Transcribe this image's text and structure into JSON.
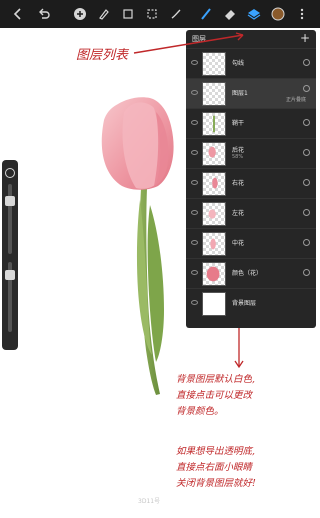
{
  "toolbar": {
    "icons": [
      "back-icon",
      "undo-icon",
      "add-icon",
      "brush-adjust-icon",
      "crop-icon",
      "select-icon",
      "smudge-icon",
      "brush-icon",
      "eraser-icon",
      "layers-icon",
      "color-icon",
      "more-icon"
    ],
    "accent": "#3aa3ff",
    "color_swatch": "#8a5a2b"
  },
  "layers_panel": {
    "title": "图层",
    "add_label": "+",
    "layers": [
      {
        "name": "勾线",
        "sub": "",
        "mode": "",
        "thumb": "empty",
        "selected": false
      },
      {
        "name": "图层1",
        "sub": "",
        "mode": "正片叠底",
        "thumb": "empty",
        "selected": true
      },
      {
        "name": "鞘干",
        "sub": "",
        "mode": "",
        "thumb": "stem",
        "selected": false
      },
      {
        "name": "后花",
        "sub": "58%",
        "mode": "",
        "thumb": "petal",
        "selected": false
      },
      {
        "name": "右花",
        "sub": "",
        "mode": "",
        "thumb": "petal",
        "selected": false
      },
      {
        "name": "左花",
        "sub": "",
        "mode": "",
        "thumb": "petal",
        "selected": false
      },
      {
        "name": "中花",
        "sub": "",
        "mode": "",
        "thumb": "petal",
        "selected": false
      },
      {
        "name": "颜色（花）",
        "sub": "",
        "mode": "",
        "thumb": "blob",
        "selected": false
      },
      {
        "name": "背景图层",
        "sub": "",
        "mode": "",
        "thumb": "solid",
        "selected": false
      }
    ]
  },
  "annotations": {
    "layers_label": "图层列表",
    "bg_lines": [
      "背景图层默认白色,",
      "直接点击可以更改",
      "背景颜色。"
    ],
    "transparent_lines": [
      "如果想导出透明底,",
      "直接点右面小眼睛",
      "关闭背景图层就好!"
    ],
    "color": "#c0282a"
  },
  "canvas": {
    "watermark": "3D11号"
  }
}
